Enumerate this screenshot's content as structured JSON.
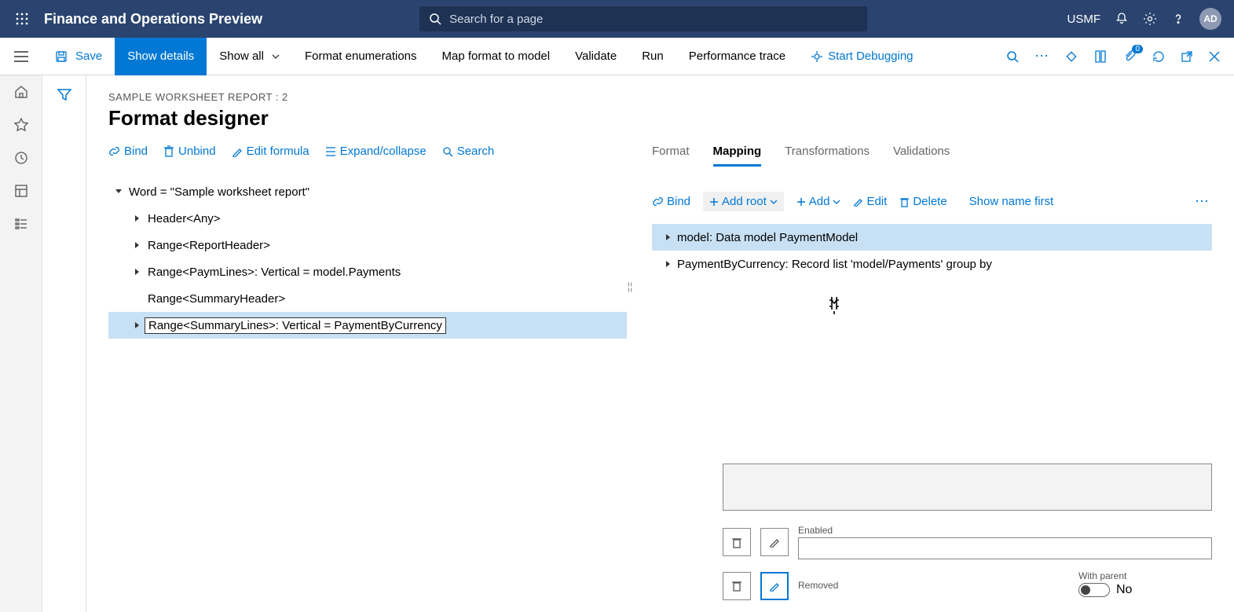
{
  "app_title": "Finance and Operations Preview",
  "search_placeholder": "Search for a page",
  "company": "USMF",
  "avatar": "AD",
  "actionbar": {
    "save": "Save",
    "show_details": "Show details",
    "show_all": "Show all",
    "format_enum": "Format enumerations",
    "map_format": "Map format to model",
    "validate": "Validate",
    "run": "Run",
    "perf": "Performance trace",
    "debug": "Start Debugging"
  },
  "breadcrumb": "SAMPLE WORKSHEET REPORT : 2",
  "page_title": "Format designer",
  "lp_toolbar": {
    "bind": "Bind",
    "unbind": "Unbind",
    "edit_formula": "Edit formula",
    "expand": "Expand/collapse",
    "search": "Search"
  },
  "tree": {
    "root": "Word = \"Sample worksheet report\"",
    "n1": "Header<Any>",
    "n2": "Range<ReportHeader>",
    "n3": "Range<PaymLines>: Vertical = model.Payments",
    "n4": "Range<SummaryHeader>",
    "n5": "Range<SummaryLines>: Vertical = PaymentByCurrency"
  },
  "rp_tabs": {
    "format": "Format",
    "mapping": "Mapping",
    "transformations": "Transformations",
    "validations": "Validations"
  },
  "rp_toolbar": {
    "bind": "Bind",
    "add_root": "Add root",
    "add": "Add",
    "edit": "Edit",
    "delete": "Delete",
    "show_name": "Show name first"
  },
  "mtree": {
    "m1": "model: Data model PaymentModel",
    "m2": "PaymentByCurrency: Record list 'model/Payments' group by"
  },
  "props": {
    "enabled": "Enabled",
    "enabled_val": "",
    "removed": "Removed",
    "with_parent": "With parent",
    "with_parent_val": "No"
  },
  "badge_count": "0"
}
